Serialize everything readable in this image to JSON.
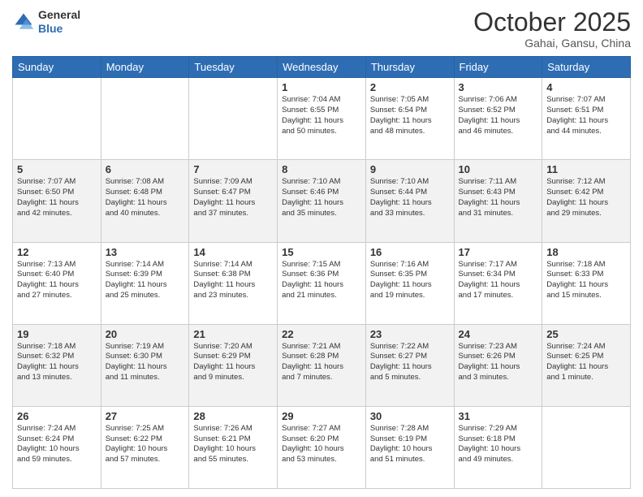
{
  "header": {
    "logo": {
      "line1": "General",
      "line2": "Blue"
    },
    "month": "October 2025",
    "location": "Gahai, Gansu, China"
  },
  "days_of_week": [
    "Sunday",
    "Monday",
    "Tuesday",
    "Wednesday",
    "Thursday",
    "Friday",
    "Saturday"
  ],
  "weeks": [
    [
      {
        "day": "",
        "info": ""
      },
      {
        "day": "",
        "info": ""
      },
      {
        "day": "",
        "info": ""
      },
      {
        "day": "1",
        "info": "Sunrise: 7:04 AM\nSunset: 6:55 PM\nDaylight: 11 hours\nand 50 minutes."
      },
      {
        "day": "2",
        "info": "Sunrise: 7:05 AM\nSunset: 6:54 PM\nDaylight: 11 hours\nand 48 minutes."
      },
      {
        "day": "3",
        "info": "Sunrise: 7:06 AM\nSunset: 6:52 PM\nDaylight: 11 hours\nand 46 minutes."
      },
      {
        "day": "4",
        "info": "Sunrise: 7:07 AM\nSunset: 6:51 PM\nDaylight: 11 hours\nand 44 minutes."
      }
    ],
    [
      {
        "day": "5",
        "info": "Sunrise: 7:07 AM\nSunset: 6:50 PM\nDaylight: 11 hours\nand 42 minutes."
      },
      {
        "day": "6",
        "info": "Sunrise: 7:08 AM\nSunset: 6:48 PM\nDaylight: 11 hours\nand 40 minutes."
      },
      {
        "day": "7",
        "info": "Sunrise: 7:09 AM\nSunset: 6:47 PM\nDaylight: 11 hours\nand 37 minutes."
      },
      {
        "day": "8",
        "info": "Sunrise: 7:10 AM\nSunset: 6:46 PM\nDaylight: 11 hours\nand 35 minutes."
      },
      {
        "day": "9",
        "info": "Sunrise: 7:10 AM\nSunset: 6:44 PM\nDaylight: 11 hours\nand 33 minutes."
      },
      {
        "day": "10",
        "info": "Sunrise: 7:11 AM\nSunset: 6:43 PM\nDaylight: 11 hours\nand 31 minutes."
      },
      {
        "day": "11",
        "info": "Sunrise: 7:12 AM\nSunset: 6:42 PM\nDaylight: 11 hours\nand 29 minutes."
      }
    ],
    [
      {
        "day": "12",
        "info": "Sunrise: 7:13 AM\nSunset: 6:40 PM\nDaylight: 11 hours\nand 27 minutes."
      },
      {
        "day": "13",
        "info": "Sunrise: 7:14 AM\nSunset: 6:39 PM\nDaylight: 11 hours\nand 25 minutes."
      },
      {
        "day": "14",
        "info": "Sunrise: 7:14 AM\nSunset: 6:38 PM\nDaylight: 11 hours\nand 23 minutes."
      },
      {
        "day": "15",
        "info": "Sunrise: 7:15 AM\nSunset: 6:36 PM\nDaylight: 11 hours\nand 21 minutes."
      },
      {
        "day": "16",
        "info": "Sunrise: 7:16 AM\nSunset: 6:35 PM\nDaylight: 11 hours\nand 19 minutes."
      },
      {
        "day": "17",
        "info": "Sunrise: 7:17 AM\nSunset: 6:34 PM\nDaylight: 11 hours\nand 17 minutes."
      },
      {
        "day": "18",
        "info": "Sunrise: 7:18 AM\nSunset: 6:33 PM\nDaylight: 11 hours\nand 15 minutes."
      }
    ],
    [
      {
        "day": "19",
        "info": "Sunrise: 7:18 AM\nSunset: 6:32 PM\nDaylight: 11 hours\nand 13 minutes."
      },
      {
        "day": "20",
        "info": "Sunrise: 7:19 AM\nSunset: 6:30 PM\nDaylight: 11 hours\nand 11 minutes."
      },
      {
        "day": "21",
        "info": "Sunrise: 7:20 AM\nSunset: 6:29 PM\nDaylight: 11 hours\nand 9 minutes."
      },
      {
        "day": "22",
        "info": "Sunrise: 7:21 AM\nSunset: 6:28 PM\nDaylight: 11 hours\nand 7 minutes."
      },
      {
        "day": "23",
        "info": "Sunrise: 7:22 AM\nSunset: 6:27 PM\nDaylight: 11 hours\nand 5 minutes."
      },
      {
        "day": "24",
        "info": "Sunrise: 7:23 AM\nSunset: 6:26 PM\nDaylight: 11 hours\nand 3 minutes."
      },
      {
        "day": "25",
        "info": "Sunrise: 7:24 AM\nSunset: 6:25 PM\nDaylight: 11 hours\nand 1 minute."
      }
    ],
    [
      {
        "day": "26",
        "info": "Sunrise: 7:24 AM\nSunset: 6:24 PM\nDaylight: 10 hours\nand 59 minutes."
      },
      {
        "day": "27",
        "info": "Sunrise: 7:25 AM\nSunset: 6:22 PM\nDaylight: 10 hours\nand 57 minutes."
      },
      {
        "day": "28",
        "info": "Sunrise: 7:26 AM\nSunset: 6:21 PM\nDaylight: 10 hours\nand 55 minutes."
      },
      {
        "day": "29",
        "info": "Sunrise: 7:27 AM\nSunset: 6:20 PM\nDaylight: 10 hours\nand 53 minutes."
      },
      {
        "day": "30",
        "info": "Sunrise: 7:28 AM\nSunset: 6:19 PM\nDaylight: 10 hours\nand 51 minutes."
      },
      {
        "day": "31",
        "info": "Sunrise: 7:29 AM\nSunset: 6:18 PM\nDaylight: 10 hours\nand 49 minutes."
      },
      {
        "day": "",
        "info": ""
      }
    ]
  ]
}
